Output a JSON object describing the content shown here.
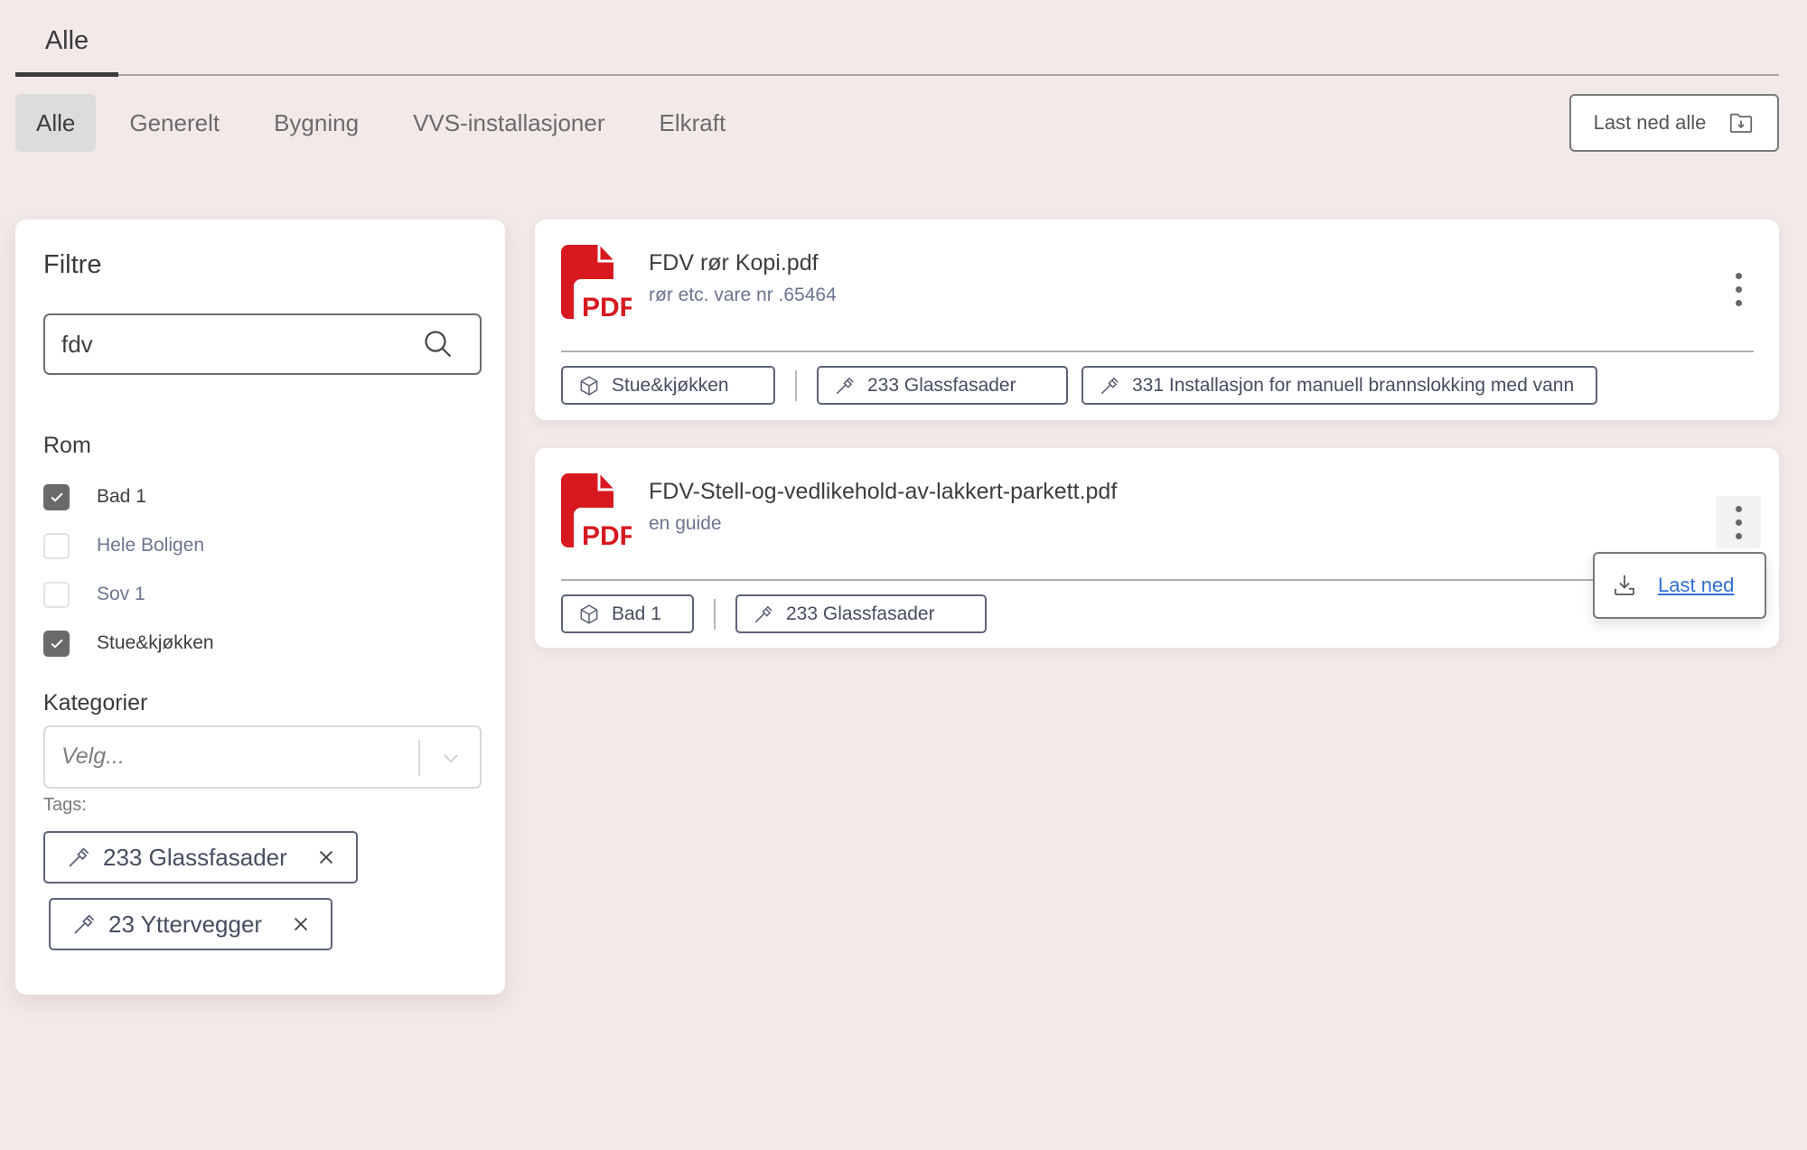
{
  "top_tabs": [
    {
      "label": "Alle",
      "active": true
    }
  ],
  "sub_tabs": [
    {
      "label": "Alle",
      "active": true
    },
    {
      "label": "Generelt",
      "active": false
    },
    {
      "label": "Bygning",
      "active": false
    },
    {
      "label": "VVS-installasjoner",
      "active": false
    },
    {
      "label": "Elkraft",
      "active": false
    }
  ],
  "download_all": {
    "label": "Last ned alle",
    "icon": "folder-download-icon"
  },
  "filters": {
    "title": "Filtre",
    "search": {
      "value": "fdv",
      "placeholder": "",
      "icon": "search-icon"
    },
    "rom": {
      "label": "Rom",
      "items": [
        {
          "label": "Bad 1",
          "checked": true
        },
        {
          "label": "Hele Boligen",
          "checked": false
        },
        {
          "label": "Sov 1",
          "checked": false
        },
        {
          "label": "Stue&kjøkken",
          "checked": true
        }
      ]
    },
    "kategorier": {
      "label": "Kategorier",
      "placeholder": "Velg..."
    },
    "tags": {
      "label": "Tags:",
      "items": [
        {
          "label": "233 Glassfasader"
        },
        {
          "label": "23 Yttervegger"
        }
      ]
    }
  },
  "documents": [
    {
      "title": "FDV rør Kopi.pdf",
      "description": "rør etc. vare nr .65464",
      "type": "PDF",
      "room_tags": [
        "Stue&kjøkken"
      ],
      "category_tags": [
        "233 Glassfasader",
        "331 Installasjon for manuell brannslokking med vann"
      ],
      "menu_open": false
    },
    {
      "title": "FDV-Stell-og-vedlikehold-av-lakkert-parkett.pdf",
      "description": "en guide",
      "type": "PDF",
      "room_tags": [
        "Bad 1"
      ],
      "category_tags": [
        "233 Glassfasader"
      ],
      "menu_open": true
    }
  ],
  "context_menu": {
    "items": [
      {
        "label": "Last ned",
        "icon": "download-tray-icon"
      }
    ]
  },
  "colors": {
    "background": "#f3e9e9",
    "pdf_red": "#d7191f",
    "link": "#2f6fd6",
    "chip_border": "#5c6378"
  }
}
